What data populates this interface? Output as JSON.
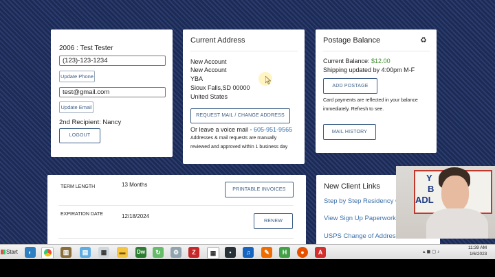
{
  "account": {
    "header": "2006 : Test Tester",
    "phone_value": "(123)-123-1234",
    "update_phone": "Update Phone",
    "email_value": "test@gmail.com",
    "update_email": "Update Email",
    "second_recipient": "2nd Recipient: Nancy",
    "logout": "LOGOUT"
  },
  "address": {
    "title": "Current Address",
    "lines": [
      "New Account",
      "New Account",
      "YBA",
      "Sioux Falls,SD 00000",
      "United States"
    ],
    "request_button": "REQUEST MAIL / CHANGE ADDRESS",
    "voicemail_prefix": "Or leave a voice mail - ",
    "voicemail_number": "605-951-9565",
    "note_line1": "Addresses & mail requests are manually",
    "note_line2": "reviewed and approved within 1 business day"
  },
  "postage": {
    "title": "Postage Balance",
    "refresh_glyph": "♻",
    "balance_label": "Current Balance: ",
    "balance_value": "$12.00",
    "shipping_note": "Shipping updated by 4:00pm M-F",
    "add_postage": "ADD POSTAGE",
    "card_note_line1": "Card payments are reflected in your balance",
    "card_note_line2": "immediately. Refresh to see.",
    "mail_history": "MAIL HISTORY"
  },
  "term": {
    "term_label": "TERM LENGTH",
    "term_value": "13 Months",
    "printable_invoices": "PRINTABLE INVOICES",
    "exp_label": "EXPIRATION DATE",
    "exp_value": "12/18/2024",
    "renew": "RENEW"
  },
  "new_client": {
    "title": "New Client Links",
    "links": [
      "Step by Step Residency G",
      "View Sign Up Paperwork",
      "USPS Change of Address"
    ]
  },
  "webcam": {
    "sign_lines": [
      "Y",
      "B",
      "ADL"
    ]
  },
  "taskbar": {
    "start": "Start",
    "time": "11:39 AM",
    "date": "1/6/2023"
  },
  "colors": {
    "link": "#3b6fa8",
    "balance": "#3a8a2a",
    "button_border": "#3b5e86"
  }
}
